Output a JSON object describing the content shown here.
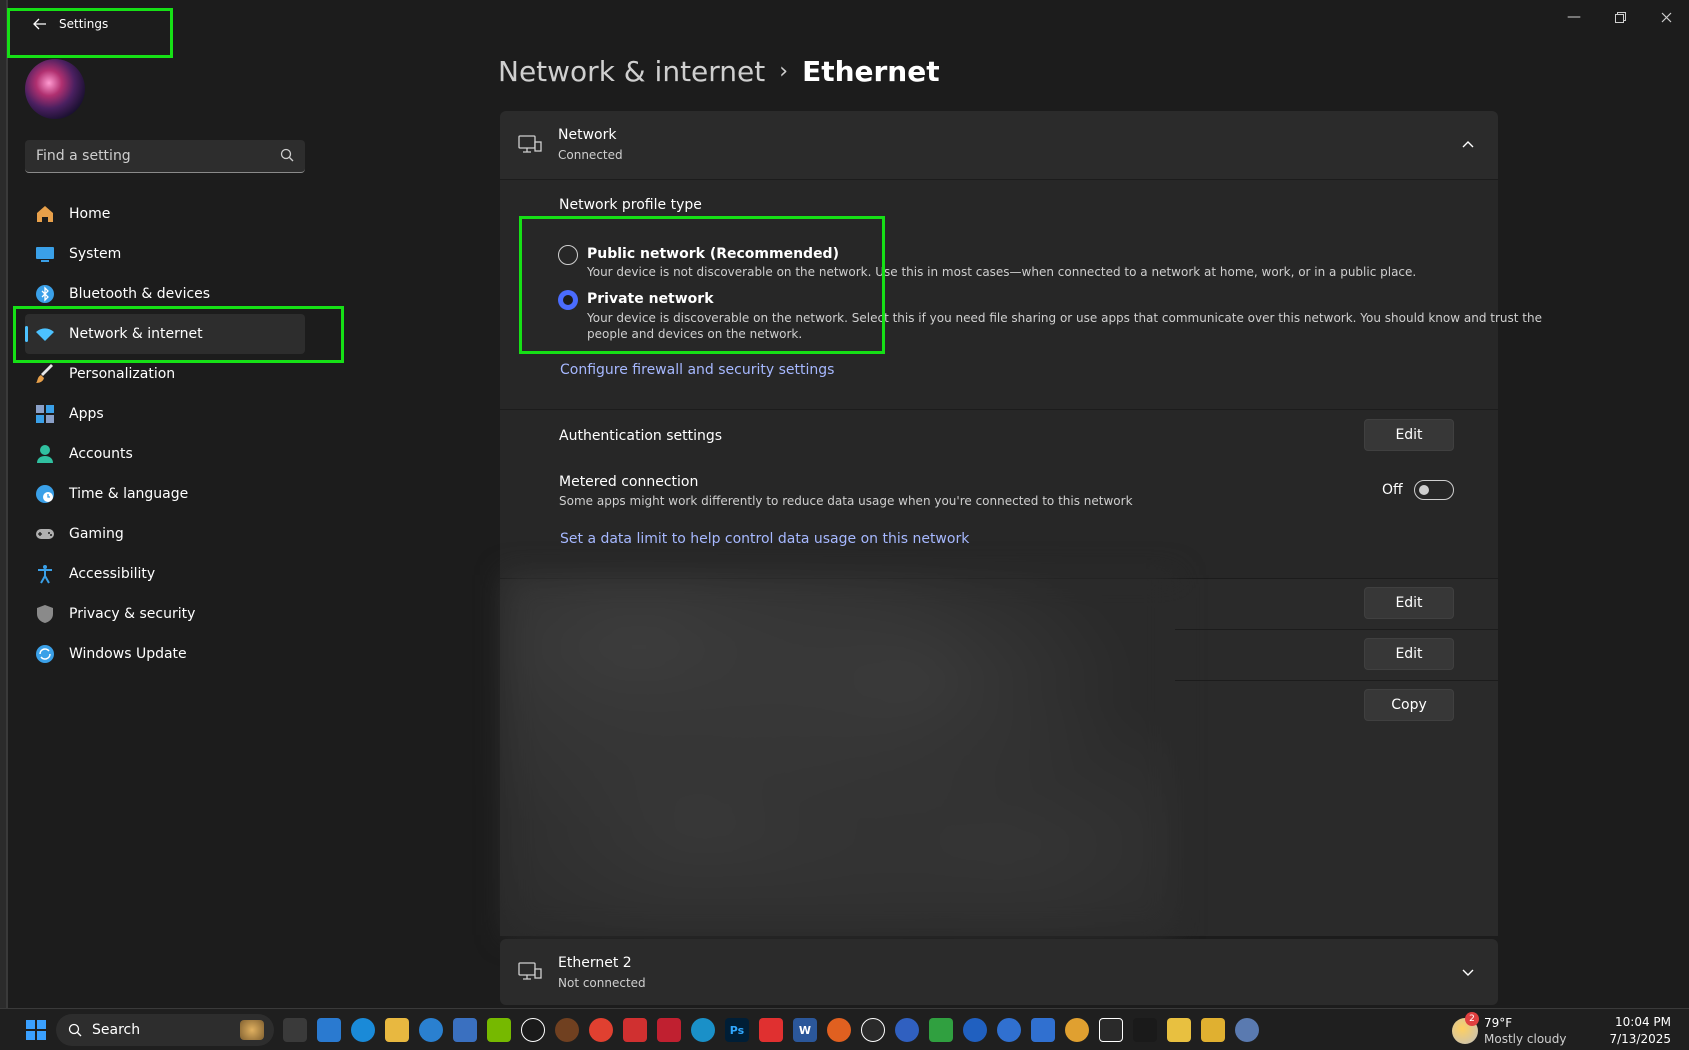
{
  "window": {
    "title": "Settings"
  },
  "sidebar": {
    "search_placeholder": "Find a setting",
    "items": [
      {
        "label": "Home",
        "icon": "home-icon",
        "color": "#e8a04a"
      },
      {
        "label": "System",
        "icon": "system-icon",
        "color": "#3aa0e8"
      },
      {
        "label": "Bluetooth & devices",
        "icon": "bluetooth-icon",
        "color": "#3aa0e8"
      },
      {
        "label": "Network & internet",
        "icon": "wifi-icon",
        "color": "#4cc2ff",
        "active": true
      },
      {
        "label": "Personalization",
        "icon": "brush-icon",
        "color": "#e8a04a"
      },
      {
        "label": "Apps",
        "icon": "apps-icon",
        "color": "#8aa0c8"
      },
      {
        "label": "Accounts",
        "icon": "person-icon",
        "color": "#30c0a0"
      },
      {
        "label": "Time & language",
        "icon": "globe-clock-icon",
        "color": "#3aa0e8"
      },
      {
        "label": "Gaming",
        "icon": "gamepad-icon",
        "color": "#b0b0b0"
      },
      {
        "label": "Accessibility",
        "icon": "accessibility-icon",
        "color": "#3aa0e8"
      },
      {
        "label": "Privacy & security",
        "icon": "shield-icon",
        "color": "#8a8a8a"
      },
      {
        "label": "Windows Update",
        "icon": "update-icon",
        "color": "#3aa0e8"
      }
    ]
  },
  "breadcrumb": {
    "parent": "Network & internet",
    "separator": "›",
    "current": "Ethernet"
  },
  "network_card": {
    "title": "Network",
    "status": "Connected",
    "profile_heading": "Network profile type",
    "public": {
      "label": "Public network (Recommended)",
      "desc": "Your device is not discoverable on the network. Use this in most cases—when connected to a network at home, work, or in a public place."
    },
    "private": {
      "label": "Private network",
      "desc_line1": "Your device is discoverable on the network. Select this if you need file sharing or use apps that communicate over this network. You should know and trust the",
      "desc_line2": "people and devices on the network.",
      "selected": true
    },
    "firewall_link": "Configure firewall and security settings"
  },
  "auth": {
    "label": "Authentication settings",
    "button": "Edit"
  },
  "metered": {
    "label": "Metered connection",
    "desc": "Some apps might work differently to reduce data usage when you're connected to this network",
    "state": "Off",
    "data_limit_link": "Set a data limit to help control data usage on this network"
  },
  "hidden_rows": {
    "edit1": "Edit",
    "edit2": "Edit",
    "copy": "Copy"
  },
  "ethernet2": {
    "title": "Ethernet 2",
    "status": "Not connected"
  },
  "taskbar": {
    "search_label": "Search",
    "weather_temp": "79°F",
    "weather_desc": "Mostly cloudy",
    "weather_badge": "2",
    "time": "10:04 PM",
    "date": "7/13/2025"
  }
}
